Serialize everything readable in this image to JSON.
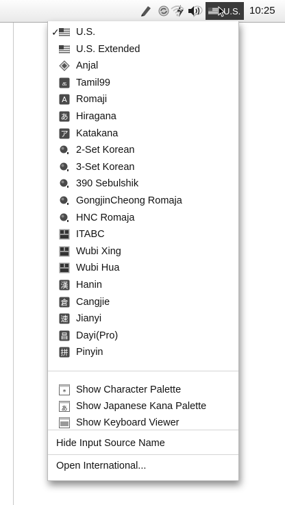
{
  "menubar": {
    "input_label": "U.S.",
    "clock": "10:25"
  },
  "menu": {
    "sources": [
      {
        "label": "U.S.",
        "icon": "us-flag-icon",
        "checked": true
      },
      {
        "label": "U.S. Extended",
        "icon": "us-flag-icon"
      },
      {
        "label": "Anjal",
        "icon": "anjal-diamond-icon"
      },
      {
        "label": "Tamil99",
        "icon": "tamil-glyph-icon"
      },
      {
        "label": "Romaji",
        "icon": "romaji-a-icon"
      },
      {
        "label": "Hiragana",
        "icon": "hiragana-icon"
      },
      {
        "label": "Katakana",
        "icon": "katakana-icon"
      },
      {
        "label": "2-Set Korean",
        "icon": "korean-2set-icon"
      },
      {
        "label": "3-Set Korean",
        "icon": "korean-3set-icon"
      },
      {
        "label": "390 Sebulshik",
        "icon": "korean-390-icon"
      },
      {
        "label": "GongjinCheong Romaja",
        "icon": "korean-gongjin-icon"
      },
      {
        "label": "HNC Romaja",
        "icon": "korean-hnc-icon"
      },
      {
        "label": "ITABC",
        "icon": "itabc-icon"
      },
      {
        "label": "Wubi Xing",
        "icon": "wubi-xing-icon"
      },
      {
        "label": "Wubi Hua",
        "icon": "wubi-hua-icon"
      },
      {
        "label": "Hanin",
        "icon": "hanin-icon"
      },
      {
        "label": "Cangjie",
        "icon": "cangjie-icon"
      },
      {
        "label": "Jianyi",
        "icon": "jianyi-icon"
      },
      {
        "label": "Dayi(Pro)",
        "icon": "dayi-icon"
      },
      {
        "label": "Pinyin",
        "icon": "pinyin-icon"
      }
    ],
    "tools": [
      {
        "label": "Show Character Palette",
        "icon": "character-palette-icon"
      },
      {
        "label": "Show Japanese Kana Palette",
        "icon": "kana-palette-icon"
      },
      {
        "label": "Show Keyboard Viewer",
        "icon": "keyboard-viewer-icon"
      }
    ],
    "hide_name": "Hide Input Source Name",
    "open_international": "Open International..."
  }
}
